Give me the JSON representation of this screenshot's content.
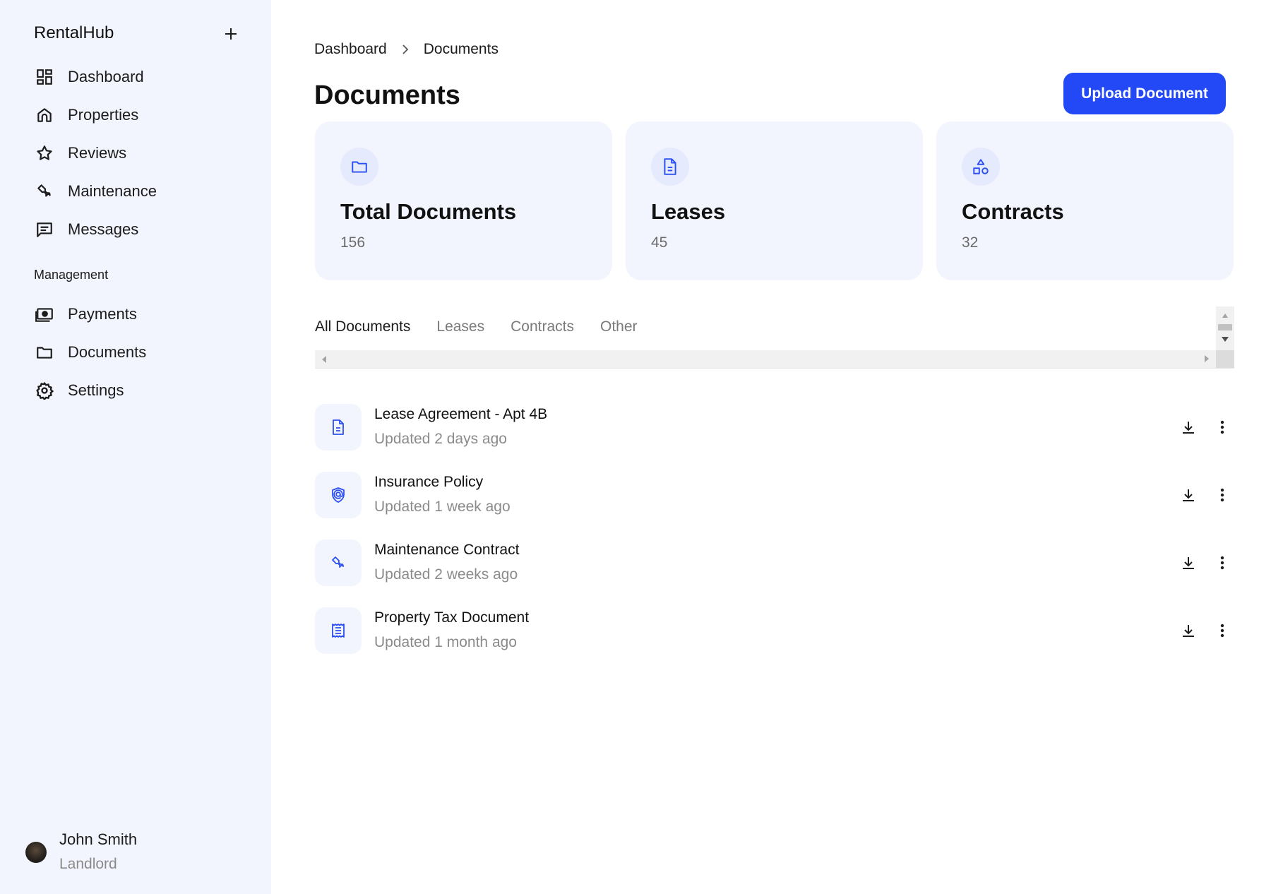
{
  "app": {
    "name": "RentalHub"
  },
  "sidebar": {
    "add_icon": "plus-icon",
    "items": [
      {
        "label": "Dashboard",
        "icon": "dashboard-icon"
      },
      {
        "label": "Properties",
        "icon": "home-icon"
      },
      {
        "label": "Reviews",
        "icon": "star-icon"
      },
      {
        "label": "Maintenance",
        "icon": "wrench-icon"
      },
      {
        "label": "Messages",
        "icon": "message-icon"
      }
    ],
    "section_title": "Management",
    "management_items": [
      {
        "label": "Payments",
        "icon": "money-icon"
      },
      {
        "label": "Documents",
        "icon": "folder-icon"
      },
      {
        "label": "Settings",
        "icon": "gear-icon"
      }
    ]
  },
  "user": {
    "name": "John Smith",
    "role": "Landlord"
  },
  "breadcrumb": {
    "parent": "Dashboard",
    "current": "Documents"
  },
  "page": {
    "title": "Documents",
    "upload_label": "Upload Document"
  },
  "stats": [
    {
      "title": "Total Documents",
      "value": "156",
      "icon": "folder-icon"
    },
    {
      "title": "Leases",
      "value": "45",
      "icon": "document-icon"
    },
    {
      "title": "Contracts",
      "value": "32",
      "icon": "shapes-icon"
    }
  ],
  "tabs": [
    {
      "label": "All Documents",
      "active": true
    },
    {
      "label": "Leases",
      "active": false
    },
    {
      "label": "Contracts",
      "active": false
    },
    {
      "label": "Other",
      "active": false
    }
  ],
  "documents": [
    {
      "name": "Lease Agreement - Apt 4B",
      "updated": "Updated 2 days ago",
      "icon": "document-icon"
    },
    {
      "name": "Insurance Policy",
      "updated": "Updated 1 week ago",
      "icon": "shield-icon"
    },
    {
      "name": "Maintenance Contract",
      "updated": "Updated 2 weeks ago",
      "icon": "wrench-icon"
    },
    {
      "name": "Property Tax Document",
      "updated": "Updated 1 month ago",
      "icon": "receipt-icon"
    }
  ],
  "colors": {
    "accent": "#2348f5",
    "sidebar_bg": "#f3f5fe",
    "icon_blue": "#2b4ff0"
  }
}
